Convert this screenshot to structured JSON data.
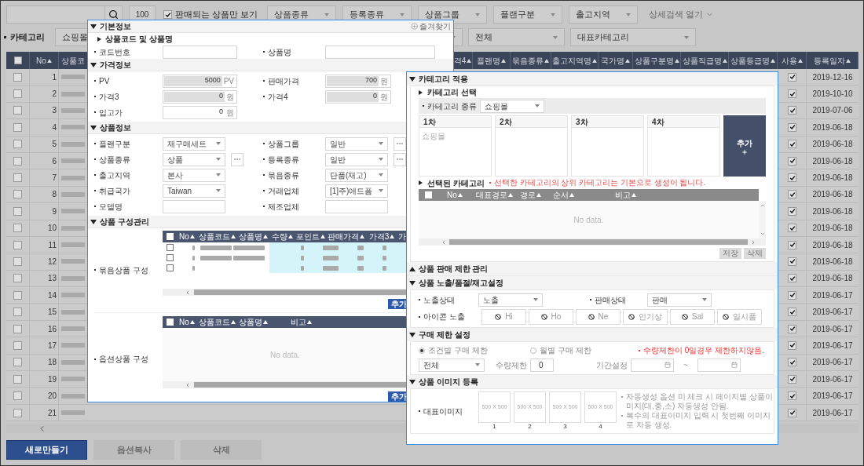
{
  "toolbar": {
    "page_size": "100",
    "sale_only": {
      "label": "판매되는 상품만 보기",
      "checked": true
    },
    "dropdowns": [
      "상품종류",
      "등록종류",
      "상품그룹",
      "플랜구분",
      "출고지역"
    ],
    "detail_search": "상세검색 열기"
  },
  "category_filter": {
    "label": "카테고리",
    "mall": "쇼핑몰",
    "scope": "전체",
    "main_category": "대표카테고리"
  },
  "table": {
    "all_checked": false,
    "columns": [
      "No",
      "상품코",
      "격4",
      "플랜명",
      "묶음종류",
      "출고지역명",
      "국가명",
      "상품구분명",
      "상품직급명",
      "상품등급명",
      "사용",
      "등록일자"
    ],
    "rows": [
      {
        "no": "1",
        "checked": false,
        "used": true,
        "date": "2019-12-16"
      },
      {
        "no": "2",
        "checked": false,
        "used": true,
        "date": "2019-10-10"
      },
      {
        "no": "3",
        "checked": false,
        "used": true,
        "date": "2019-07-06"
      },
      {
        "no": "4",
        "checked": false,
        "used": true,
        "date": "2019-06-18"
      },
      {
        "no": "5",
        "checked": false,
        "used": true,
        "date": "2019-06-18"
      },
      {
        "no": "6",
        "checked": false,
        "used": true,
        "date": "2019-06-18"
      },
      {
        "no": "7",
        "checked": false,
        "used": true,
        "date": "2019-06-18"
      },
      {
        "no": "8",
        "checked": false,
        "used": true,
        "date": "2019-06-18"
      },
      {
        "no": "9",
        "checked": false,
        "used": true,
        "date": "2019-06-18"
      },
      {
        "no": "10",
        "checked": false,
        "used": true,
        "date": "2019-06-18"
      },
      {
        "no": "11",
        "checked": false,
        "used": true,
        "date": "2019-06-18"
      },
      {
        "no": "12",
        "checked": false,
        "used": true,
        "date": "2019-06-18"
      },
      {
        "no": "13",
        "checked": false,
        "used": true,
        "date": "2019-06-18"
      },
      {
        "no": "14",
        "checked": false,
        "used": true,
        "date": "2019-06-17"
      },
      {
        "no": "15",
        "checked": false,
        "used": true,
        "date": "2019-06-17"
      },
      {
        "no": "16",
        "checked": false,
        "used": true,
        "date": "2019-06-17"
      },
      {
        "no": "17",
        "checked": false,
        "used": true,
        "date": "2019-06-17"
      },
      {
        "no": "18",
        "checked": false,
        "used": true,
        "date": "2019-06-17"
      },
      {
        "no": "19",
        "checked": false,
        "used": true,
        "date": "2019-06-17"
      },
      {
        "no": "20",
        "checked": false,
        "used": true,
        "date": "2019-06-17"
      },
      {
        "no": "21",
        "checked": false,
        "used": true,
        "date": "2019-06-17"
      }
    ]
  },
  "footer_buttons": [
    {
      "label": "새로만들기",
      "disabled": false
    },
    {
      "label": "옵션복사",
      "disabled": true
    },
    {
      "label": "삭제",
      "disabled": true
    }
  ],
  "product_dialog": {
    "basic": {
      "title": "기본정보",
      "expanded": true,
      "favorite": "즐겨찾기",
      "subtitle": "상품코드 및 상품명",
      "fields": [
        {
          "label": "코드번호"
        },
        {
          "label": "상품명"
        }
      ]
    },
    "price": {
      "title": "가격정보",
      "expanded": true,
      "fields": [
        {
          "label": "PV",
          "value": "5000",
          "unit": "PV",
          "readonly": true
        },
        {
          "label": "판매가격",
          "value": "700",
          "unit": "원",
          "readonly": true
        },
        {
          "label": "가격3",
          "value": "0",
          "unit": "원",
          "readonly": true
        },
        {
          "label": "가격4",
          "value": "0",
          "unit": "원",
          "readonly": true
        },
        {
          "label": "입고가",
          "value": "0",
          "unit": "원",
          "readonly": false
        }
      ]
    },
    "info": {
      "title": "상품정보",
      "expanded": true,
      "fields": [
        {
          "label": "플랜구분",
          "kind": "select",
          "value": "재구매세트",
          "more": false
        },
        {
          "label": "상품그룹",
          "kind": "select",
          "value": "일반",
          "more": true
        },
        {
          "label": "상품종류",
          "kind": "select",
          "value": "상품",
          "more": true
        },
        {
          "label": "등록종류",
          "kind": "select",
          "value": "일반",
          "more": true
        },
        {
          "label": "출고지역",
          "kind": "select",
          "value": "본사",
          "more": false
        },
        {
          "label": "묶음종류",
          "kind": "select",
          "value": "단품(재고)",
          "more": false
        },
        {
          "label": "취급국가",
          "kind": "select",
          "value": "Taiwan",
          "more": false
        },
        {
          "label": "거래업체",
          "kind": "select",
          "value": "[1]주)애드폼",
          "more": false
        },
        {
          "label": "모델명",
          "kind": "text"
        },
        {
          "label": "제조업체",
          "kind": "text"
        }
      ]
    },
    "composition": {
      "title": "상품 구성관리",
      "expanded": true,
      "bundle": {
        "label": "묶음상품 구성",
        "all_checked": false,
        "columns": [
          "No",
          "상품코드",
          "상품명",
          "수량",
          "포인트",
          "판매가격",
          "가격3",
          "가"
        ],
        "rows": [
          {
            "checked": false
          },
          {
            "checked": false
          },
          {
            "checked": false
          }
        ],
        "add_button": "추가"
      },
      "options": {
        "label": "옵션상품 구성",
        "all_checked": false,
        "columns": [
          "No",
          "상품코드",
          "상품명",
          "비고"
        ],
        "empty": "No data.",
        "add_button": "추가"
      }
    }
  },
  "category_dialog": {
    "apply": {
      "title": "카테고리 적용",
      "expanded": true,
      "select_title": "카테고리 선택",
      "kind_label": "카테고리 종류",
      "kind_value": "쇼핑몰",
      "levels": [
        {
          "title": "1차",
          "items": [
            "쇼핑몰"
          ]
        },
        {
          "title": "2차"
        },
        {
          "title": "3차"
        },
        {
          "title": "4차"
        }
      ],
      "add_button": "추가",
      "selected_title": "선택된 카테고리",
      "selected_note": "선택한 카테고리의 상위 카테고리는 기본으로 생성이 됩니다.",
      "all_checked": false,
      "columns": [
        "No",
        "대표경로",
        "경로",
        "순서",
        "비고"
      ],
      "empty": "No data.",
      "actions": [
        {
          "label": "저장",
          "disabled": true
        },
        {
          "label": "삭제",
          "disabled": true
        }
      ]
    },
    "sale_limit": {
      "title": "상품 판매 제한 관리",
      "expanded": false
    },
    "exposure": {
      "title": "상품 노출/품절/재고설정",
      "expanded": true,
      "fields": [
        {
          "label": "노출상태",
          "value": "노출"
        },
        {
          "label": "판매상태",
          "value": "판매"
        }
      ],
      "icon_label": "아이콘 노출",
      "icons": [
        "Hi",
        "Ho",
        "Ne",
        "인기상",
        "Sal",
        "일시품"
      ]
    },
    "purchase_limit": {
      "title": "구매 제한 설정",
      "expanded": true,
      "options": [
        {
          "label": "조건별 구매 제한",
          "selected": true
        },
        {
          "label": "월별 구매 제한",
          "selected": false
        }
      ],
      "note": "수량제한이 0일경우 제한하지않음.",
      "scope": "전체",
      "qty_label": "수량제한",
      "qty": "0",
      "period_label": "기간설정",
      "range_sep": "~"
    },
    "images": {
      "title": "상품 이미지 등록",
      "expanded": true,
      "label": "대표이미지",
      "slots": [
        {
          "size": "500 X 500",
          "number": "1"
        },
        {
          "size": "500 X 500",
          "number": "2"
        },
        {
          "size": "500 X 500",
          "number": "3"
        },
        {
          "size": "500 X 500",
          "number": "4"
        }
      ],
      "notes": [
        "자동생성 옵션 미 체크 시 페이지별 상품이미지(대,중,소) 자동생성 안됨.",
        "복수의 대표이미지 입력 시 첫번째 이미지로 자동 생성."
      ]
    }
  }
}
